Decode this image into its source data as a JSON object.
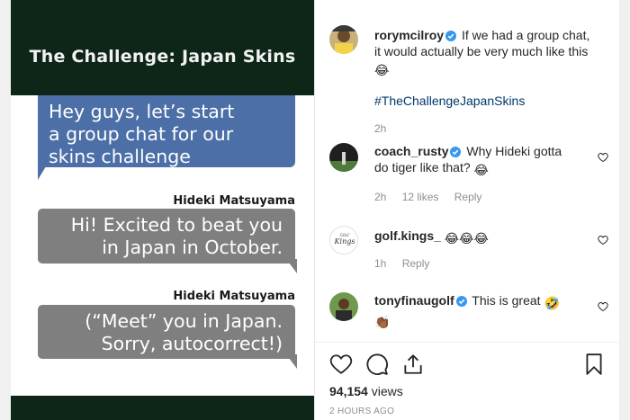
{
  "media": {
    "title": "The Challenge: Japan Skins",
    "messages": [
      {
        "line1": "Hey guys, let’s start",
        "line2": "a group chat for our",
        "line3": "skins challenge"
      },
      {
        "sender": "Hideki Matsuyama",
        "line1": "Hi! Excited to beat you",
        "line2": "in Japan in October."
      },
      {
        "sender": "Hideki Matsuyama",
        "line1": "(“Meet” you in Japan.",
        "line2": "Sorry, autocorrect!)"
      }
    ],
    "colors": {
      "banner": "#0d2617",
      "blue_bubble": "#4b6fa6",
      "gray_bubble": "#7f7f7f"
    }
  },
  "caption": {
    "username": "rorymcilroy",
    "text_line1": "If we had a group chat,",
    "text_line2": "it would actually be very much like this",
    "emoji": "😂",
    "hashtag": "#TheChallengeJapanSkins",
    "time": "2h"
  },
  "comments": [
    {
      "username": "coach_rusty",
      "text": "Why Hideki gotta",
      "text2": "do tiger like that?",
      "emoji": "😂",
      "time": "2h",
      "likes": "12 likes",
      "reply": "Reply"
    },
    {
      "username": "golf.kings_",
      "emoji": "😂😂😂",
      "time": "1h",
      "reply": "Reply"
    },
    {
      "username": "tonyfinaugolf",
      "text": "This is great",
      "emoji": "🤣",
      "emoji2": "👏🏾"
    }
  ],
  "stats": {
    "views": "94,154",
    "views_label": "views",
    "posted": "2 HOURS AGO"
  },
  "icons": [
    "heart-icon",
    "comment-icon",
    "share-icon",
    "bookmark-icon",
    "verified-icon"
  ]
}
